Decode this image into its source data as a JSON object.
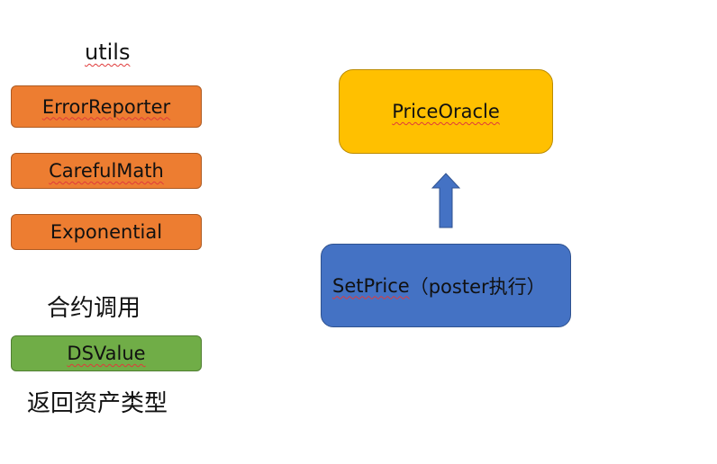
{
  "utils": {
    "title": "utils",
    "items": [
      {
        "label": "ErrorReporter"
      },
      {
        "label": "CarefulMath"
      },
      {
        "label": "Exponential"
      }
    ]
  },
  "contract_call": {
    "title": "合约调用",
    "item": {
      "label": "DSValue"
    },
    "caption": "返回资产类型"
  },
  "flow": {
    "target": {
      "label": "PriceOracle"
    },
    "source": {
      "label": "SetPrice",
      "suffix": "（poster执行）"
    }
  },
  "colors": {
    "utils_fill": "#ed7d31",
    "dsvalue_fill": "#70ad47",
    "oracle_fill": "#ffc000",
    "setprice_fill": "#4472c4",
    "arrow_fill": "#4472c4"
  },
  "icons": {
    "arrow": "up-arrow-icon"
  }
}
